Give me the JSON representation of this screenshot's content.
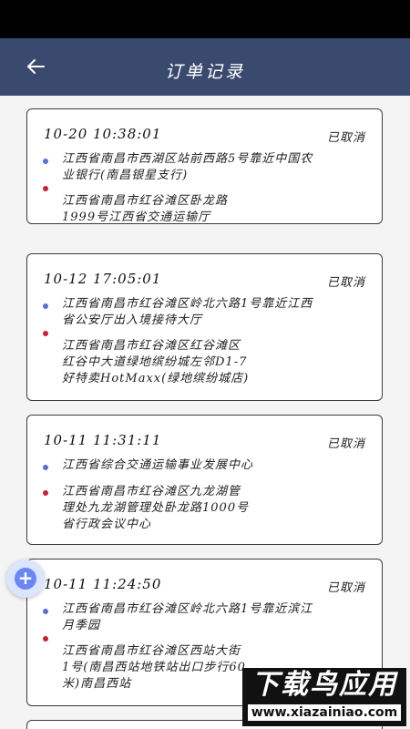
{
  "header": {
    "title": "订单记录"
  },
  "status_label": "已取消",
  "orders": [
    {
      "time": "10-20  10:38:01",
      "status": "已取消",
      "start_lines": [
        "江西省南昌市西湖区站前西路5号靠近中国农",
        "业银行(南昌银星支行)"
      ],
      "end_lines": [
        "江西省南昌市红谷滩区卧龙路",
        "1999号江西省交通运输厅"
      ]
    },
    {
      "time": "10-12  17:05:01",
      "status": "已取消",
      "start_lines": [
        "江西省南昌市红谷滩区岭北六路1号靠近江西",
        "省公安厅出入境接待大厅"
      ],
      "end_lines": [
        "江西省南昌市红谷滩区红谷滩区",
        "红谷中大道绿地缤纷城左邻D1-7",
        "好特卖HotMaxx(绿地缤纷城店)"
      ]
    },
    {
      "time": "10-11  11:31:11",
      "status": "已取消",
      "start_lines": [
        "江西省综合交通运输事业发展中心"
      ],
      "end_lines": [
        "江西省南昌市红谷滩区九龙湖管",
        "理处九龙湖管理处卧龙路1000号",
        "省行政会议中心"
      ]
    },
    {
      "time": "10-11  11:24:50",
      "status": "已取消",
      "start_lines": [
        "江西省南昌市红谷滩区岭北六路1号靠近滨江",
        "月季园"
      ],
      "end_lines": [
        "江西省南昌市红谷滩区西站大街",
        "1号(南昌西站地铁站出口步行60",
        "米)南昌西站"
      ]
    }
  ],
  "fab": {
    "icon": "plus-icon"
  },
  "watermark": {
    "main": "下载鸟应用",
    "url": "www.xiazainiao.com"
  }
}
